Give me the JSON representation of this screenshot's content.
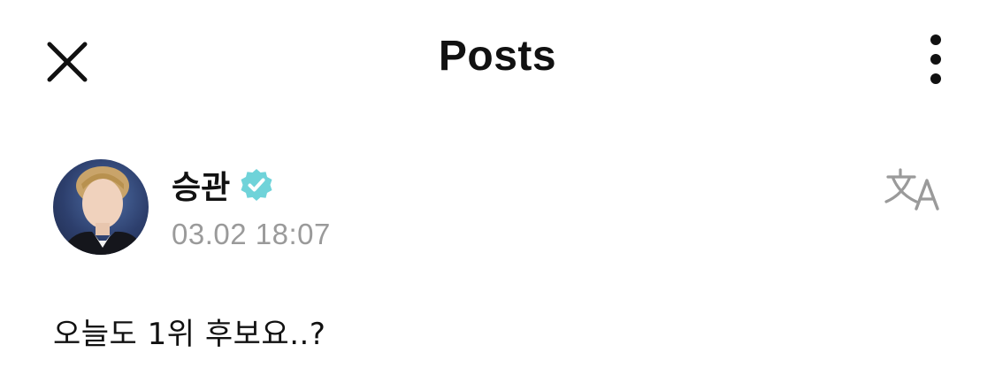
{
  "header": {
    "title": "Posts",
    "close_icon": "close-icon",
    "more_icon": "more-vertical-icon"
  },
  "post": {
    "author": "승관",
    "verified_icon": "verified-badge-icon",
    "verified_color": "#6fd3d9",
    "timestamp": "03.02 18:07",
    "translate_icon": "translate-icon",
    "body": "오늘도 1위 후보요..?"
  }
}
